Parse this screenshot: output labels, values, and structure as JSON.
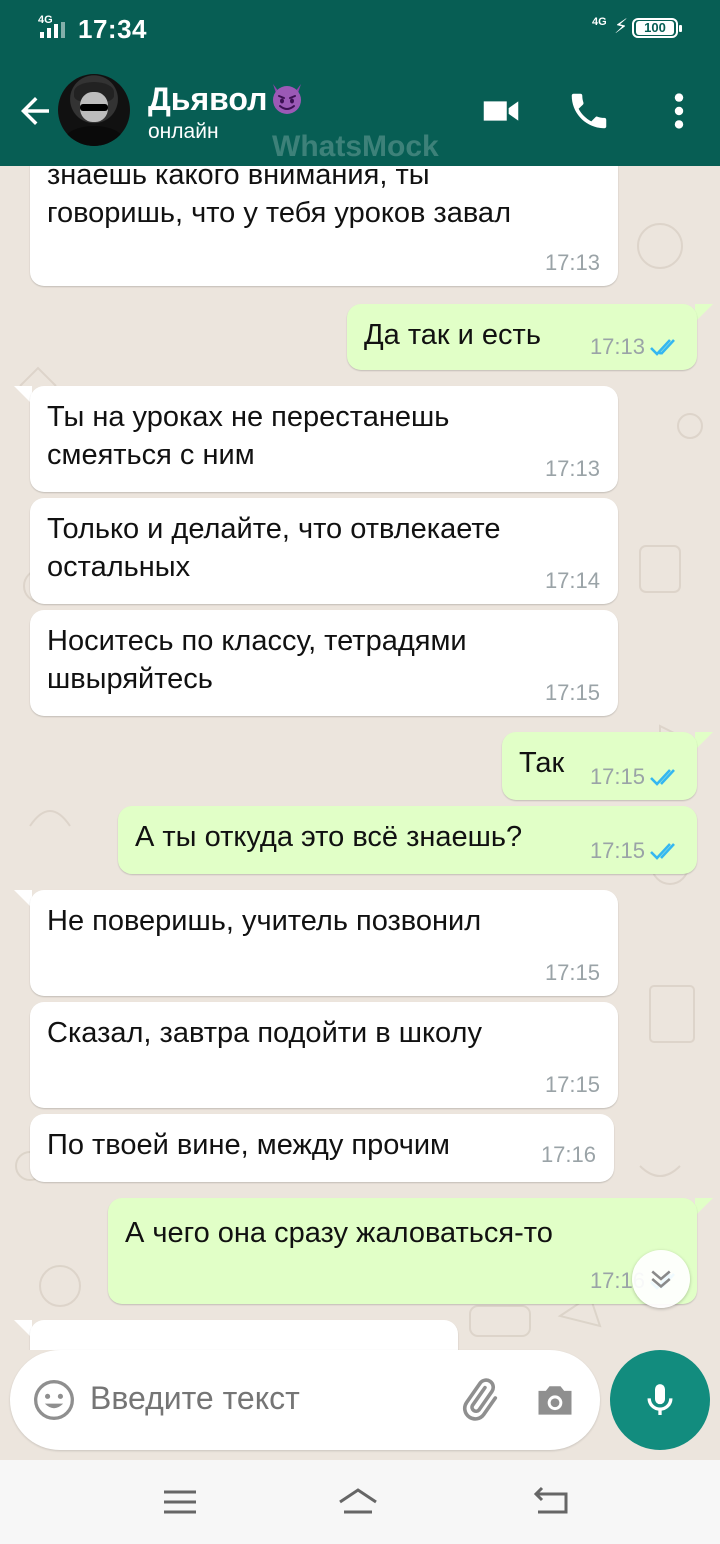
{
  "status_bar": {
    "signal_label": "4G",
    "time": "17:34",
    "network_label": "4G",
    "battery": "100"
  },
  "header": {
    "contact_name": "Дьявол",
    "contact_emoji": "smiling-imp-emoji",
    "status": "онлайн",
    "watermark": "WhatsMock",
    "icons": [
      "back-arrow-icon",
      "video-call-icon",
      "phone-icon",
      "more-vert-icon"
    ]
  },
  "messages": [
    {
      "dir": "in",
      "lines": [
        "знаешь какого внимания, ты",
        "говоришь, что у тебя уроков завал"
      ],
      "time": "17:13"
    },
    {
      "dir": "out",
      "lines": [
        "Да так и есть"
      ],
      "time": "17:13",
      "read": true
    },
    {
      "dir": "in",
      "lines": [
        "Ты на уроках не перестанешь",
        "смеяться с ним"
      ],
      "time": "17:13"
    },
    {
      "dir": "in",
      "lines": [
        "Только и делайте, что отвлекаете",
        "остальных"
      ],
      "time": "17:14"
    },
    {
      "dir": "in",
      "lines": [
        "Носитесь по классу, тетрадями",
        "швыряйтесь"
      ],
      "time": "17:15"
    },
    {
      "dir": "out",
      "lines": [
        "Так"
      ],
      "time": "17:15",
      "read": true
    },
    {
      "dir": "out",
      "lines": [
        "А ты откуда это всё знаешь?"
      ],
      "time": "17:15",
      "read": true
    },
    {
      "dir": "in",
      "lines": [
        "Не поверишь, учитель позвонил"
      ],
      "time": "17:15"
    },
    {
      "dir": "in",
      "lines": [
        "Сказал, завтра подойти в школу"
      ],
      "time": "17:15"
    },
    {
      "dir": "in",
      "lines": [
        "По твоей вине, между прочим"
      ],
      "time": "17:16"
    },
    {
      "dir": "out",
      "lines": [
        "А чего она сразу жаловаться-то"
      ],
      "time": "17:16",
      "read": true
    }
  ],
  "input": {
    "placeholder": "Введите текст",
    "icons": [
      "emoji-icon",
      "attach-icon",
      "camera-icon",
      "mic-icon"
    ]
  },
  "colors": {
    "header": "#075e54",
    "chat_background": "#ece5dd",
    "outgoing_bubble": "#e1ffc7",
    "incoming_bubble": "#ffffff",
    "read_ticks": "#34b7f1",
    "mic_button": "#128c7e"
  }
}
